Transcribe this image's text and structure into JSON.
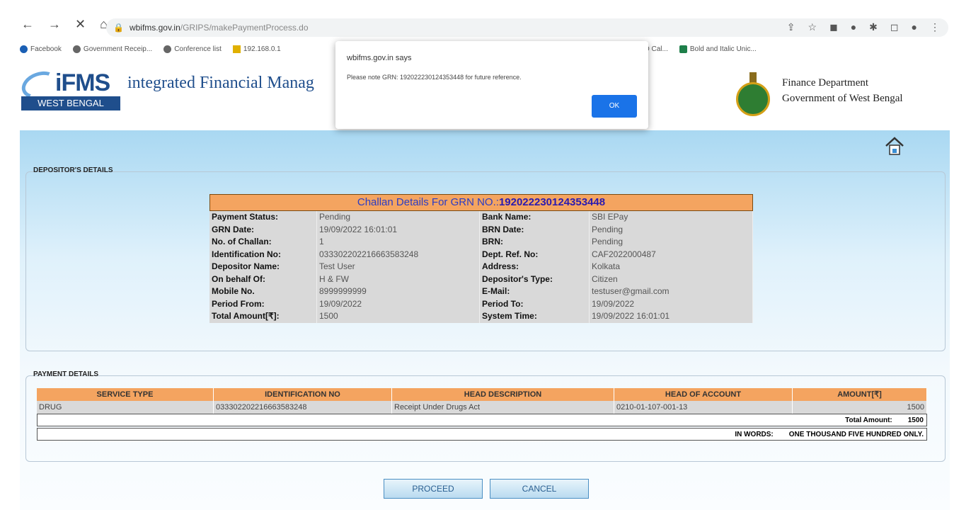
{
  "browser": {
    "url_domain": "wbifms.gov.in",
    "url_path": "/GRIPS/makePaymentProcess.do",
    "bookmarks": [
      "Facebook",
      "Government Receip...",
      "Conference list",
      "192.168.0.1",
      "HDFC BANK RD Cal...",
      "Bold and Italic Unic..."
    ]
  },
  "header": {
    "logo_main": "iFMS",
    "logo_band": "WEST BENGAL",
    "system_title": "integrated Financial Manag",
    "dept_line1": "Finance Department",
    "dept_line2": "Government of West Bengal"
  },
  "dialog": {
    "title": "wbifms.gov.in says",
    "message": "Please note GRN: 192022230124353448 for future reference.",
    "ok_label": "OK"
  },
  "depositor": {
    "legend": "DEPOSITOR'S DETAILS",
    "heading_prefix": "Challan Details For GRN NO.:",
    "grn": "192022230124353448",
    "rows": [
      [
        "Payment Status:",
        "Pending",
        "Bank Name:",
        "SBI EPay"
      ],
      [
        "GRN Date:",
        "19/09/2022 16:01:01",
        "BRN Date:",
        "Pending"
      ],
      [
        "No. of Challan:",
        "1",
        "BRN:",
        "Pending"
      ],
      [
        "Identification No:",
        "033302202216663583248",
        "Dept. Ref. No:",
        "CAF2022000487"
      ],
      [
        "Depositor Name:",
        "Test User",
        "Address:",
        "Kolkata"
      ],
      [
        "On behalf Of:",
        "H & FW",
        "Depositor's Type:",
        "Citizen"
      ],
      [
        "Mobile No.",
        "8999999999",
        "E-Mail:",
        "testuser@gmail.com"
      ],
      [
        "Period From:",
        "19/09/2022",
        "Period To:",
        "19/09/2022"
      ],
      [
        "Total Amount[₹]:",
        "1500",
        "System Time:",
        "19/09/2022 16:01:01"
      ]
    ]
  },
  "payment": {
    "legend": "PAYMENT DETAILS",
    "headers": [
      "SERVICE TYPE",
      "IDENTIFICATION NO",
      "HEAD DESCRIPTION",
      "HEAD OF ACCOUNT",
      "AMOUNT[₹]"
    ],
    "row": [
      "DRUG",
      "033302202216663583248",
      "Receipt Under Drugs Act",
      "0210-01-107-001-13",
      "1500"
    ],
    "total_label": "Total Amount:",
    "total_value": "1500",
    "words_label": "IN WORDS:",
    "words_value": "ONE THOUSAND FIVE HUNDRED ONLY."
  },
  "actions": {
    "proceed_label": "PROCEED",
    "cancel_label": "CANCEL"
  }
}
